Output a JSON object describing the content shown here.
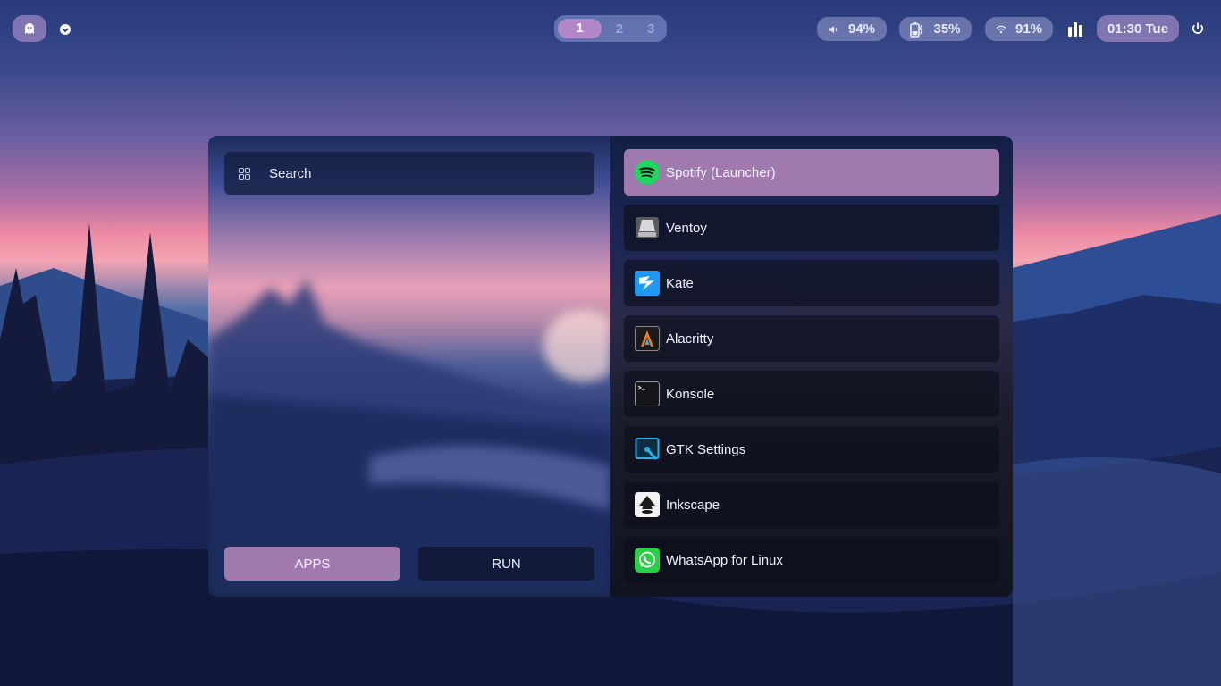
{
  "topbar": {
    "workspaces": [
      {
        "label": "1",
        "active": true
      },
      {
        "label": "2",
        "active": false
      },
      {
        "label": "3",
        "active": false
      }
    ],
    "volume": "94%",
    "battery": "35%",
    "wifi": "91%",
    "clock": "01:30 Tue",
    "icons": [
      "ghost-icon",
      "chevron-down-icon",
      "volume-icon",
      "battery-charging-icon",
      "wifi-icon",
      "bar-chart-icon",
      "power-icon"
    ]
  },
  "launcher": {
    "search_placeholder": "Search",
    "modes": {
      "apps": "APPS",
      "run": "RUN"
    },
    "apps": [
      {
        "name": "Spotify (Launcher)",
        "icon": "spotify-icon",
        "selected": true
      },
      {
        "name": "Ventoy",
        "icon": "ventoy-icon"
      },
      {
        "name": "Kate",
        "icon": "kate-icon"
      },
      {
        "name": "Alacritty",
        "icon": "alacritty-icon"
      },
      {
        "name": "Konsole",
        "icon": "konsole-icon"
      },
      {
        "name": "GTK Settings",
        "icon": "gtk-settings-icon"
      },
      {
        "name": "Inkscape",
        "icon": "inkscape-icon"
      },
      {
        "name": "WhatsApp for Linux",
        "icon": "whatsapp-icon"
      }
    ]
  },
  "colors": {
    "accent": "#a07aaf",
    "pill_bg": "#9aa0d8",
    "text": "#f1f1ff"
  }
}
